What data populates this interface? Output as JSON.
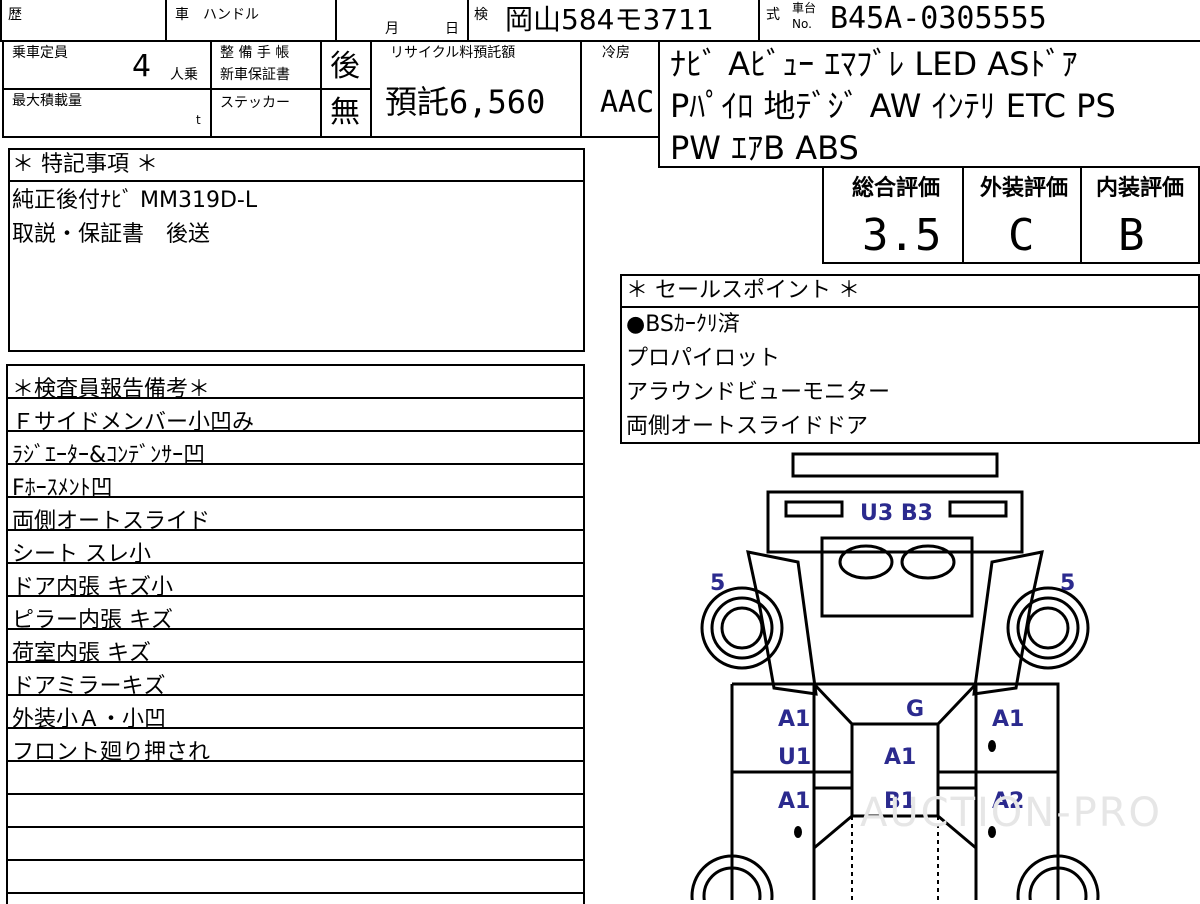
{
  "header": {
    "history_label": "歴",
    "car_label": "車",
    "handle_label": "ハンドル",
    "month_label": "月",
    "day_label": "日",
    "inspection_label": "検",
    "plate": "岡山584モ3711",
    "type_label": "式",
    "chassis_label_1": "車台",
    "chassis_label_2": "No.",
    "chassis_no": "B45A-0305555"
  },
  "specs": {
    "capacity_label": "乗車定員",
    "capacity_value": "4",
    "capacity_unit": "人乗",
    "load_label": "最大積載量",
    "load_unit": "t",
    "maintenance_label": "整 備 手 帳",
    "warranty_label": "新車保証書",
    "maintenance_value": "後",
    "sticker_label": "ステッカー",
    "sticker_value": "無",
    "recycle_label": "リサイクル料預託額",
    "recycle_value": "預託6,560",
    "aircon_label": "冷房",
    "aircon_value": "AAC"
  },
  "equipment": [
    "ﾅﾋﾞ Aﾋﾞｭｰ ｴﾏﾌﾞﾚ LED ASﾄﾞｱ",
    "Pﾊﾟｲﾛ 地ﾃﾞｼﾞ AW ｲﾝﾃﾘ ETC PS",
    "PW ｴｱB ABS"
  ],
  "special_notes": {
    "title": "＊ 特記事項 ＊",
    "lines": [
      "純正後付ﾅﾋﾞ MM319D-L",
      "取説・保証書　後送"
    ]
  },
  "scores": {
    "overall_label": "総合評価",
    "overall_value": "3.5",
    "exterior_label": "外装評価",
    "exterior_value": "C",
    "interior_label": "内装評価",
    "interior_value": "B"
  },
  "sales_points": {
    "title": "＊ セールスポイント ＊",
    "lines": [
      "●BSｶｰｸﾘ済",
      "プロパイロット",
      "アラウンドビューモニター",
      "両側オートスライドドア"
    ]
  },
  "inspector": {
    "title": "＊検査員報告備考＊",
    "lines": [
      "Ｆサイドメンバー小凹み",
      "ﾗｼﾞｴｰﾀｰ&ｺﾝﾃﾞﾝｻｰ凹",
      "Fﾎｰｽﾒﾝﾄ凹",
      "両側オートスライド",
      "シート スレ小",
      "ドア内張 キズ小",
      "ピラー内張 キズ",
      "荷室内張 キズ",
      "ドアミラーキズ",
      "外装小Ａ・小凹",
      "フロント廻り押され",
      "",
      "",
      "",
      ""
    ]
  },
  "diagram": {
    "marks": {
      "rear_center": "U3 B3",
      "left_top": "5",
      "right_top": "5",
      "roof": "G",
      "left_front_1": "A1",
      "left_front_2": "U1",
      "center_1": "A1",
      "right_front": "A1",
      "left_rear": "A1",
      "center_2": "B1",
      "right_rear": "A2"
    }
  },
  "watermark": "AUCTION-PRO",
  "colors": {
    "ink": "#000000",
    "marks": "#2b2a8e"
  }
}
